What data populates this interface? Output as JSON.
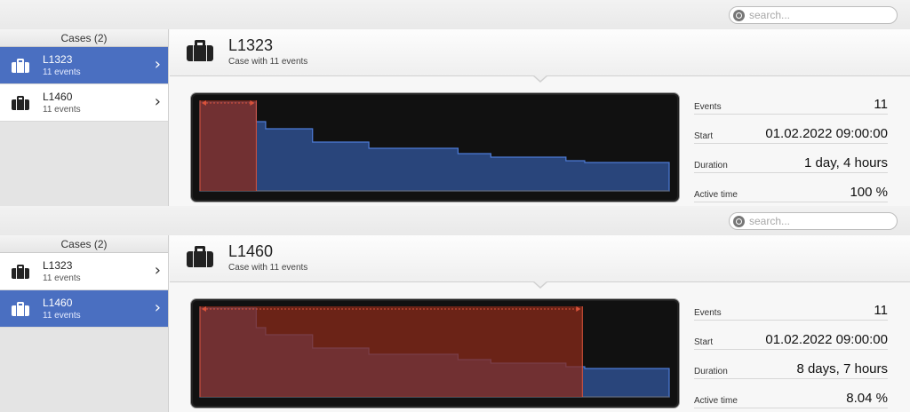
{
  "search": {
    "placeholder": "search..."
  },
  "sidebar": {
    "header": "Cases (2)"
  },
  "cases": [
    {
      "title": "L1323",
      "subtitle": "11 events"
    },
    {
      "title": "L1460",
      "subtitle": "11 events"
    }
  ],
  "panels": [
    {
      "selected_index": 0,
      "case_title": "L1323",
      "case_subtitle": "Case with 11 events",
      "stats": [
        {
          "label": "Events",
          "value": "11"
        },
        {
          "label": "Start",
          "value": "01.02.2022 09:00:00"
        },
        {
          "label": "Duration",
          "value": "1 day, 4 hours"
        },
        {
          "label": "Active time",
          "value": "100 %"
        }
      ],
      "highlight_fraction": 0.12
    },
    {
      "selected_index": 1,
      "case_title": "L1460",
      "case_subtitle": "Case with 11 events",
      "stats": [
        {
          "label": "Events",
          "value": "11"
        },
        {
          "label": "Start",
          "value": "01.02.2022 09:00:00"
        },
        {
          "label": "Duration",
          "value": "8 days, 7 hours"
        },
        {
          "label": "Active time",
          "value": "8.04 %"
        }
      ],
      "highlight_fraction": 0.815
    }
  ],
  "colors": {
    "accent": "#4a6fc1",
    "series_blue": "#2e4f8e",
    "series_blue_line": "#4d7bd6",
    "highlight_red": "#8a2a1a",
    "highlight_line": "#d9523a"
  },
  "icons": {
    "case": "briefcase-icon",
    "chevron": "chevron-right-icon",
    "search": "search-icon"
  },
  "chart_data": {
    "type": "area",
    "step": true,
    "x": [
      0,
      0.12,
      0.14,
      0.24,
      0.36,
      0.55,
      0.62,
      0.78,
      0.82,
      1.0
    ],
    "values": [
      1.0,
      0.78,
      0.7,
      0.55,
      0.48,
      0.42,
      0.38,
      0.34,
      0.32,
      0.08
    ],
    "xlabel": "",
    "ylabel": "",
    "grid": false
  }
}
